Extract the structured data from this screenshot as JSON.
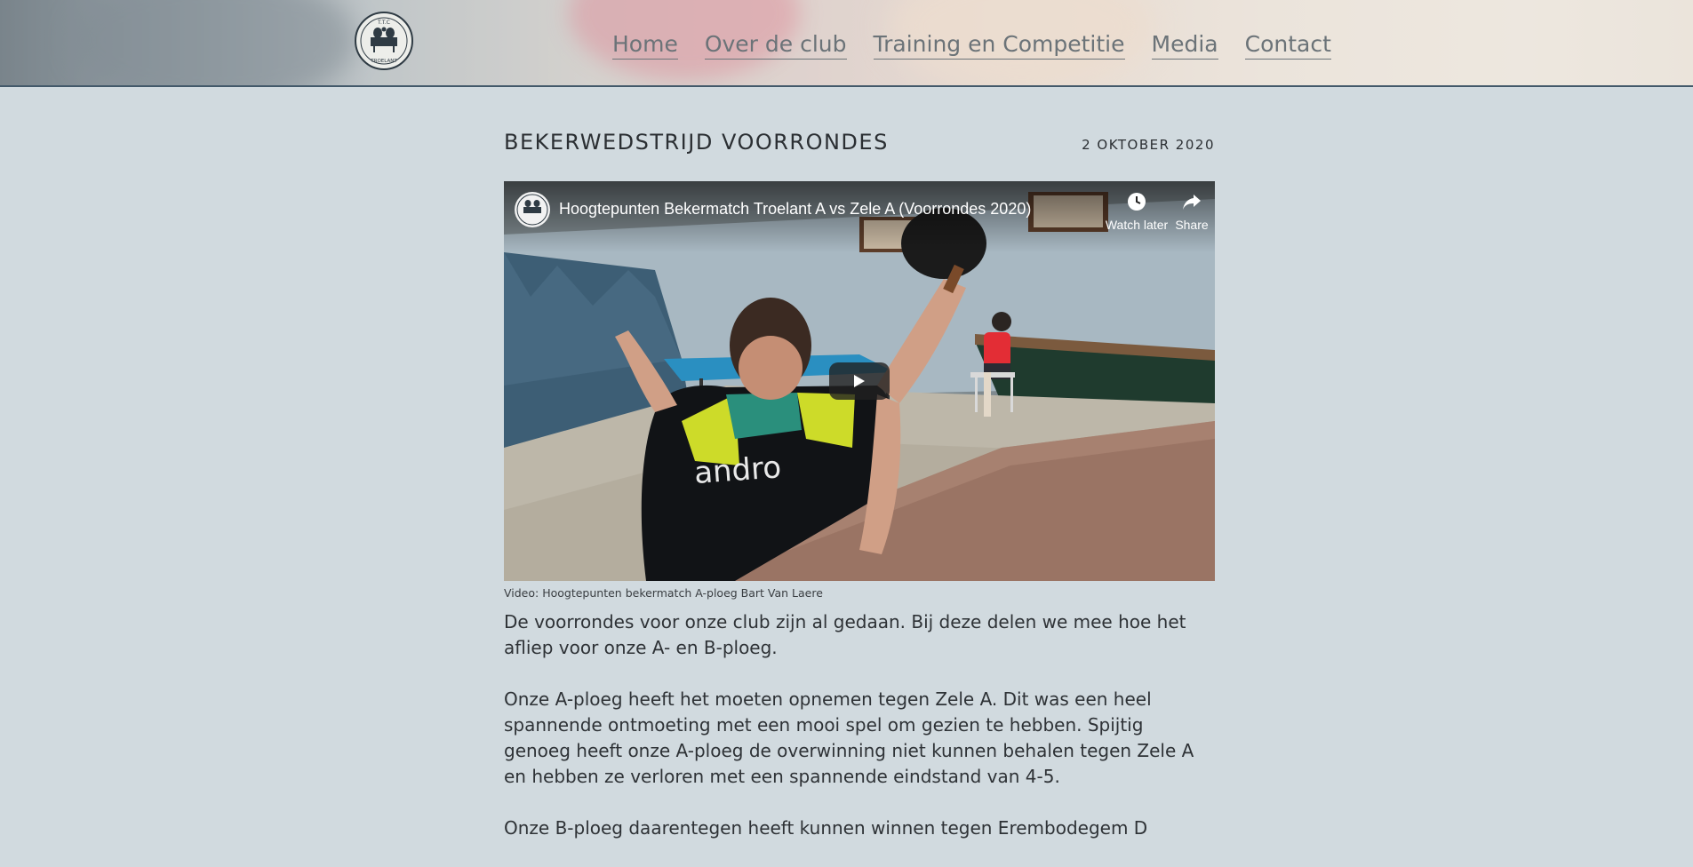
{
  "header": {
    "logo_alt": "TTC Troelant logo",
    "logo_top_text": "T.T.C",
    "logo_bottom_text": "TROELANT",
    "nav": [
      {
        "label": "Home"
      },
      {
        "label": "Over de club"
      },
      {
        "label": "Training en Competitie"
      },
      {
        "label": "Media"
      },
      {
        "label": "Contact"
      }
    ]
  },
  "post": {
    "title": "BEKERWEDSTRIJD VOORRONDES",
    "date": "2 OKTOBER 2020",
    "video": {
      "title": "Hoogtepunten Bekermatch Troelant A vs Zele A (Voorrondes 2020)",
      "watch_later": "Watch later",
      "share": "Share",
      "jersey_text": "andro"
    },
    "video_caption": "Video: Hoogtepunten bekermatch A-ploeg Bart Van Laere",
    "paragraphs": [
      "De voorrondes voor onze club zijn al gedaan. Bij deze delen we mee hoe het afliep voor onze A- en B-ploeg.",
      "Onze A-ploeg heeft het moeten opnemen tegen Zele A. Dit was een heel spannende ontmoeting met een mooi spel om gezien te hebben. Spijtig genoeg heeft onze A-ploeg de overwinning niet kunnen behalen tegen Zele A en hebben ze verloren met een spannende eindstand van 4-5.",
      "Onze B-ploeg daarentegen heeft kunnen winnen tegen Erembodegem D"
    ]
  },
  "colors": {
    "page_background": "#d1dadf",
    "header_border": "#43596a",
    "nav_text": "#6b7378",
    "body_text": "#2e3236"
  }
}
